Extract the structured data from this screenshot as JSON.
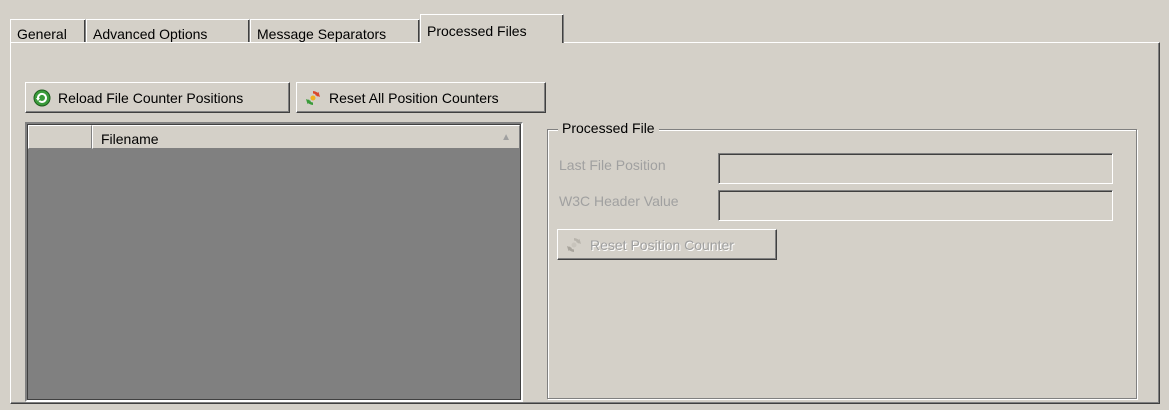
{
  "tabs": [
    {
      "label": "General",
      "active": false
    },
    {
      "label": "Advanced Options",
      "active": false
    },
    {
      "label": "Message Separators",
      "active": false
    },
    {
      "label": "Processed Files",
      "active": true
    }
  ],
  "toolbar": {
    "reload_label": "Reload File Counter Positions",
    "reload_icon": "reload-icon",
    "reset_all_label": "Reset All Position Counters",
    "reset_all_icon": "reset-icon"
  },
  "grid": {
    "columns": [
      "",
      "Filename"
    ],
    "sort_indicator": "▲",
    "rows": []
  },
  "processed_file": {
    "title": "Processed File",
    "last_position_label": "Last File Position",
    "last_position_value": "",
    "w3c_header_label": "W3C Header Value",
    "w3c_header_value": "",
    "reset_label": "Reset Position Counter",
    "reset_icon": "reset-icon"
  },
  "colors": {
    "background": "#d4d0c8",
    "grid_empty": "#808080",
    "disabled_text": "#a0a0a0"
  }
}
